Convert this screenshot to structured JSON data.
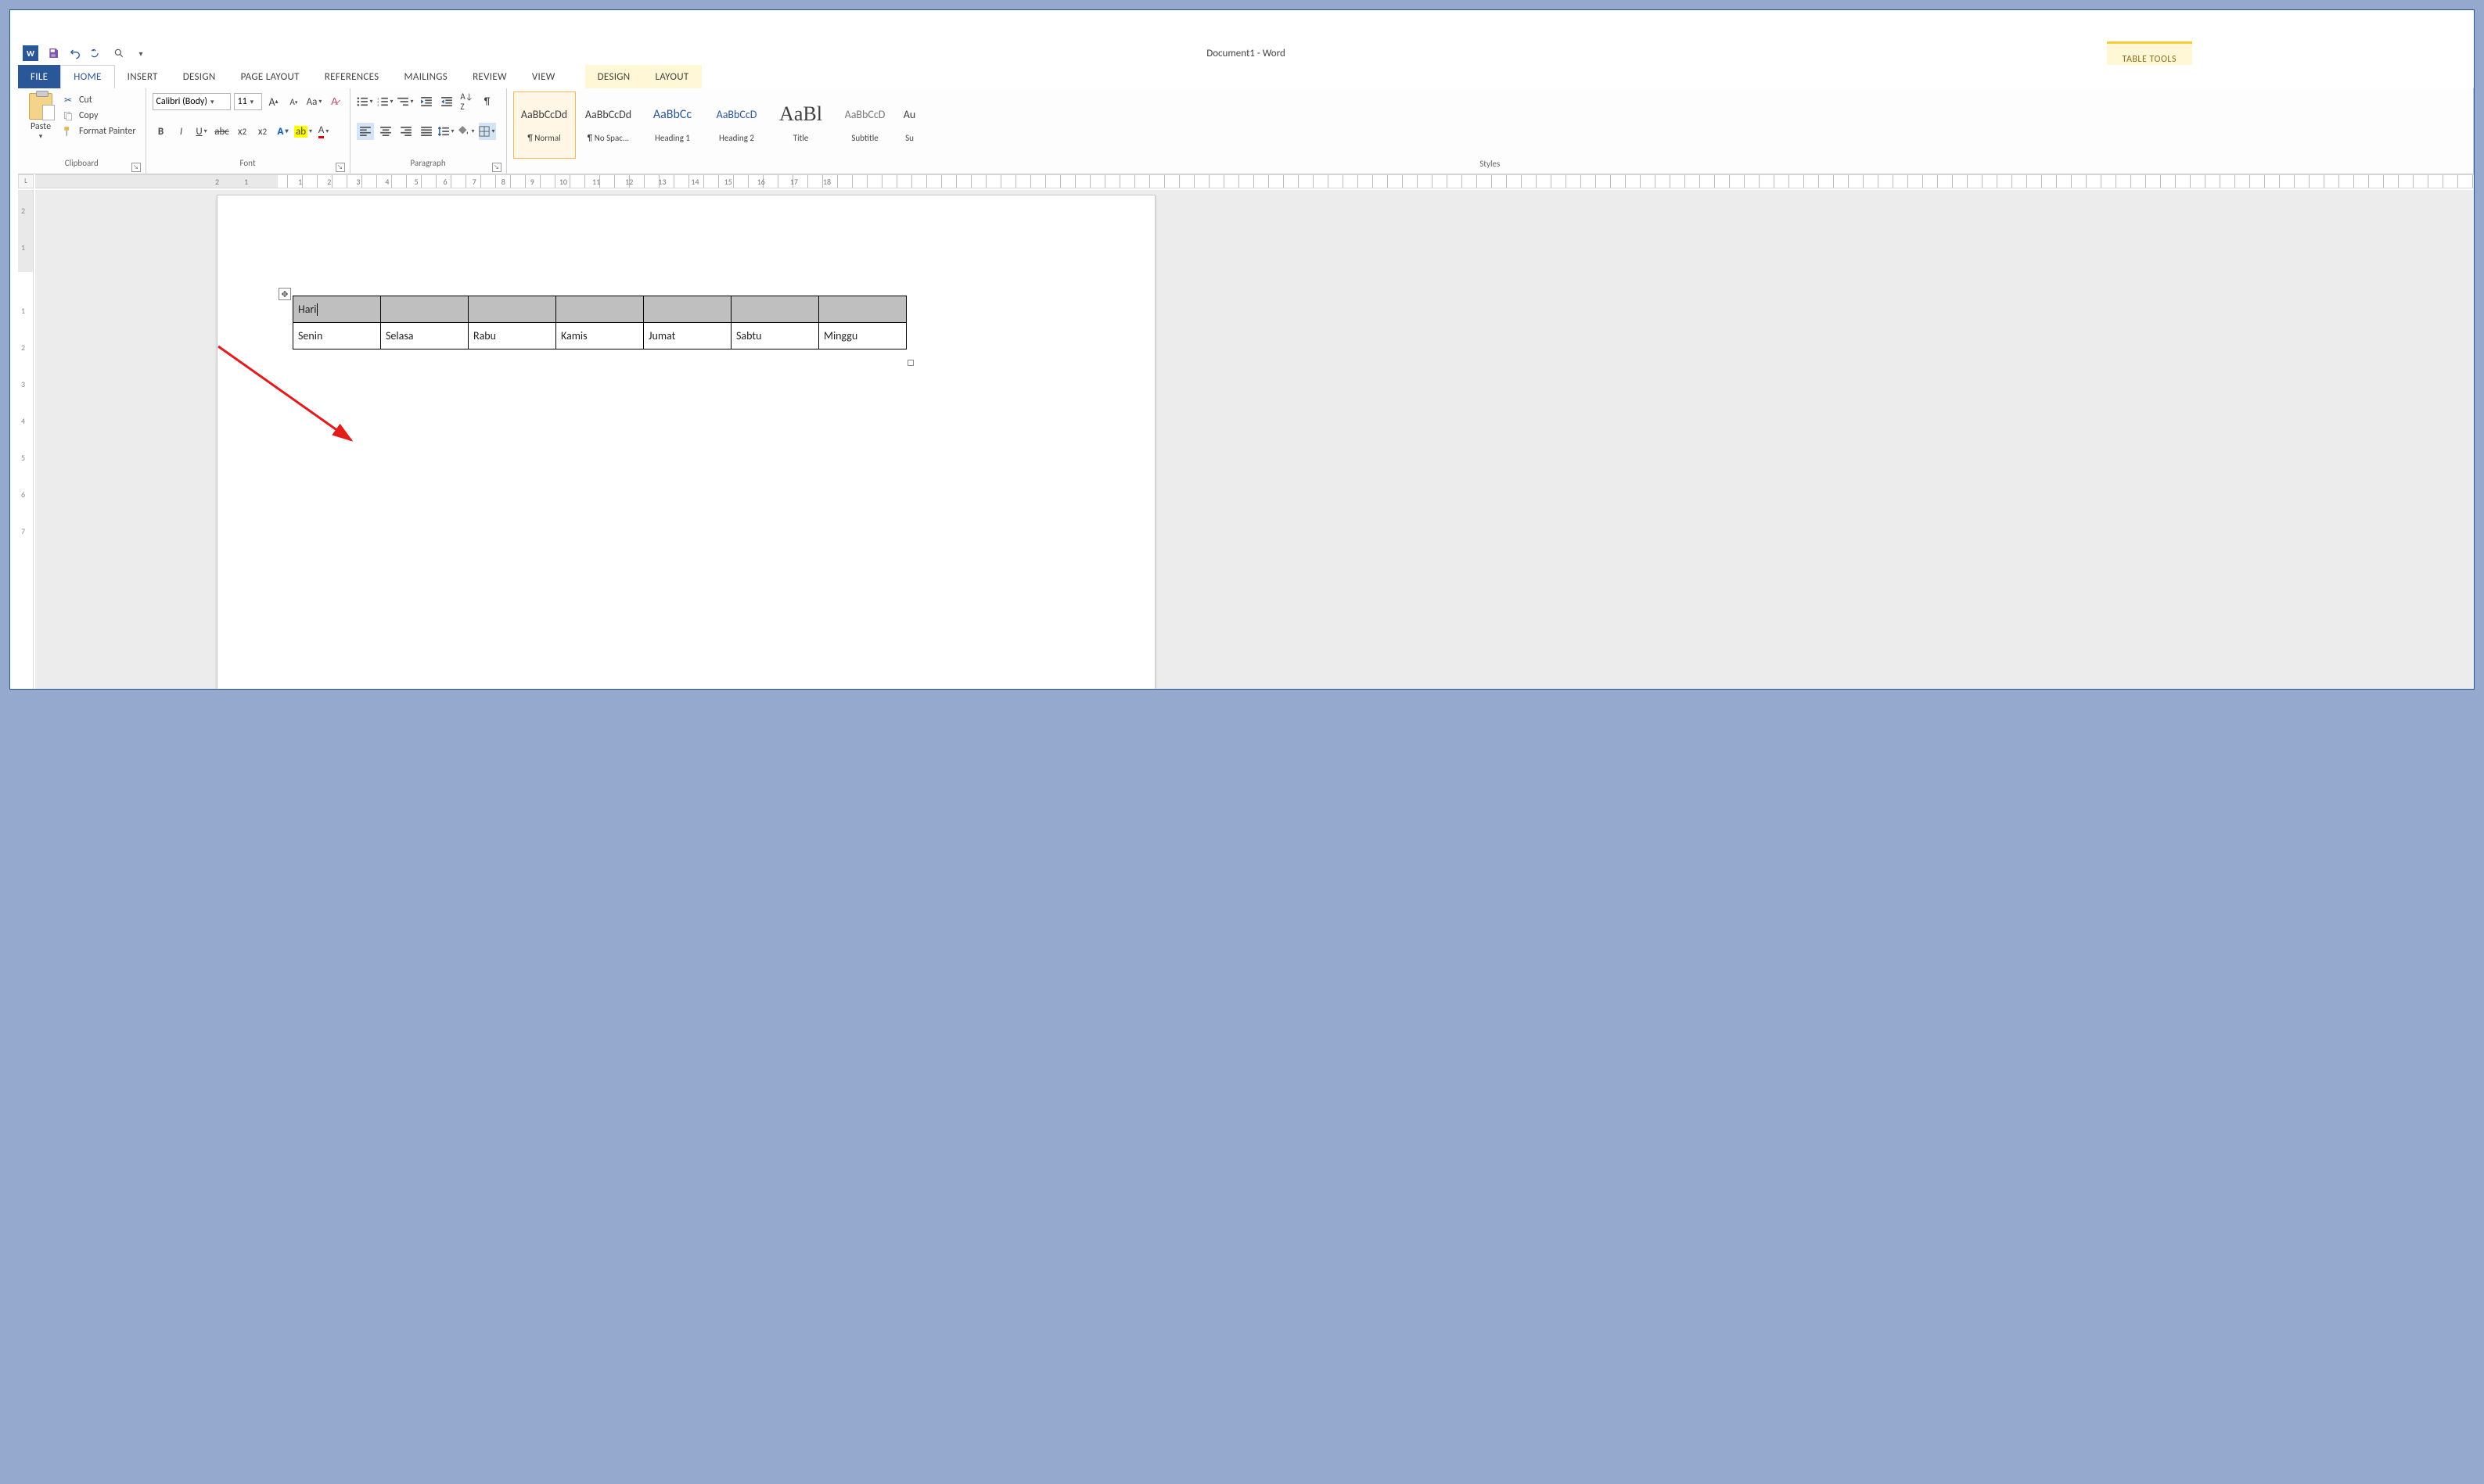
{
  "qat": {
    "word_icon_label": "W"
  },
  "title": "Document1 - Word",
  "table_tools_label": "TABLE TOOLS",
  "tabs": {
    "file": "FILE",
    "home": "HOME",
    "insert": "INSERT",
    "design": "DESIGN",
    "page_layout": "PAGE LAYOUT",
    "references": "REFERENCES",
    "mailings": "MAILINGS",
    "review": "REVIEW",
    "view": "VIEW",
    "ctx_design": "DESIGN",
    "ctx_layout": "LAYOUT"
  },
  "clipboard": {
    "paste": "Paste",
    "cut": "Cut",
    "copy": "Copy",
    "format_painter": "Format Painter",
    "group_label": "Clipboard"
  },
  "font": {
    "family": "Calibri (Body)",
    "size": "11",
    "group_label": "Font"
  },
  "paragraph": {
    "group_label": "Paragraph"
  },
  "styles": {
    "group_label": "Styles",
    "items": [
      {
        "sample": "AaBbCcDd",
        "name": "¶ Normal"
      },
      {
        "sample": "AaBbCcDd",
        "name": "¶ No Spac..."
      },
      {
        "sample": "AaBbCc",
        "name": "Heading 1"
      },
      {
        "sample": "AaBbCcD",
        "name": "Heading 2"
      },
      {
        "sample": "AaBl",
        "name": "Title"
      },
      {
        "sample": "AaBbCcD",
        "name": "Subtitle"
      },
      {
        "sample": "Au",
        "name": "Su"
      }
    ]
  },
  "ruler": {
    "h": [
      "2",
      "1",
      "",
      "1",
      "2",
      "3",
      "4",
      "5",
      "6",
      "7",
      "8",
      "9",
      "10",
      "11",
      "12",
      "13",
      "14",
      "15",
      "16",
      "17",
      "18"
    ],
    "v": [
      "2",
      "1",
      "",
      "1",
      "2",
      "3",
      "4",
      "5",
      "6",
      "7"
    ]
  },
  "document": {
    "table": {
      "header": [
        "Hari",
        "",
        "",
        "",
        "",
        "",
        ""
      ],
      "row": [
        "Senin",
        "Selasa",
        "Rabu",
        "Kamis",
        "Jumat",
        "Sabtu",
        "Minggu"
      ]
    }
  }
}
